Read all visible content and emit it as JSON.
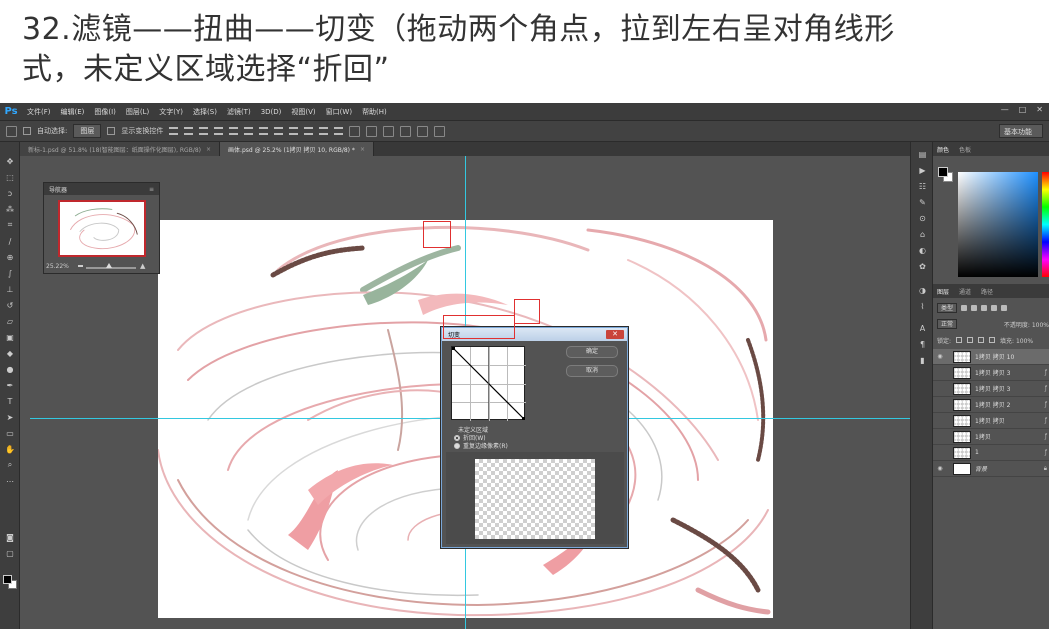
{
  "caption": {
    "line1": "32.滤镜——扭曲——切变（拖动两个角点，拉到左右呈对角线形",
    "line2": "式，未定义区域选择“折回”"
  },
  "app": {
    "logo": "Ps",
    "menus": [
      "文件(F)",
      "编辑(E)",
      "图像(I)",
      "图层(L)",
      "文字(Y)",
      "选择(S)",
      "滤镜(T)",
      "3D(D)",
      "视图(V)",
      "窗口(W)",
      "帮助(H)"
    ],
    "window_controls": [
      "—",
      "□",
      "✕"
    ]
  },
  "options": {
    "auto_select_label": "自动选择:",
    "auto_select_value": "图层",
    "show_transform_label": "显示变换控件",
    "workspace": "基本功能"
  },
  "tabs": [
    {
      "label": "新标-1.psd @ 51.8% (18(智能图层：纸面操作化图层), RGB/8)",
      "close": "×"
    },
    {
      "label": "画体.psd @ 25.2% (1拷贝 拷贝 10, RGB/8) *",
      "close": "×"
    }
  ],
  "navigator": {
    "title": "导航器",
    "menu": "≡",
    "zoom": "25.22%"
  },
  "color_panel": {
    "tabs": [
      "颜色",
      "色板"
    ]
  },
  "layers_panel": {
    "tabs": [
      "图层",
      "通道",
      "路径"
    ],
    "filter_kind": "类型",
    "blend_mode": "正常",
    "opacity_label": "不透明度: 100%",
    "lock_label": "锁定:",
    "fill_label": "填充: 100%",
    "layers": [
      {
        "name": "1拷贝 拷贝 10",
        "visible": true,
        "selected": true,
        "thumb": "checker"
      },
      {
        "name": "1拷贝 拷贝 3",
        "visible": false,
        "selected": false,
        "thumb": "checker"
      },
      {
        "name": "1拷贝 拷贝 3",
        "visible": false,
        "selected": false,
        "thumb": "checker"
      },
      {
        "name": "1拷贝 拷贝 2",
        "visible": false,
        "selected": false,
        "thumb": "checker"
      },
      {
        "name": "1拷贝 拷贝",
        "visible": false,
        "selected": false,
        "thumb": "checker"
      },
      {
        "name": "1拷贝",
        "visible": false,
        "selected": false,
        "thumb": "checker"
      },
      {
        "name": "1",
        "visible": false,
        "selected": false,
        "thumb": "checker"
      },
      {
        "name": "背景",
        "visible": true,
        "selected": false,
        "thumb": "white",
        "italic": true
      }
    ]
  },
  "shear_dialog": {
    "title": "切变",
    "ok": "确定",
    "cancel": "取消",
    "undefined_area_label": "未定义区域",
    "option_wrap": "折回(W)",
    "option_repeat": "重复边缘像素(R)",
    "selected_option": "折回(W)",
    "close_glyph": "✕"
  },
  "colors": {
    "ps_bg": "#535353",
    "highlight": "#e03030",
    "guide": "#33c8e0",
    "swirl_pink": "#e9a0a4",
    "swirl_green": "#8fae93",
    "swirl_brown": "#8a6a5e"
  }
}
